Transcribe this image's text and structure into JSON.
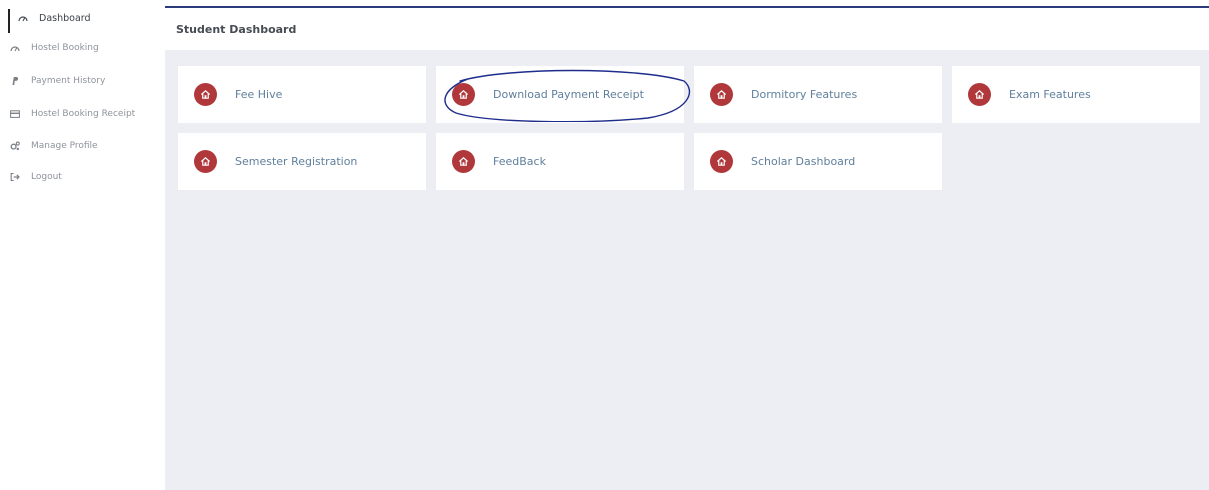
{
  "sidebar": {
    "items": [
      {
        "label": "Dashboard",
        "icon": "dashboard-icon",
        "active": true
      },
      {
        "label": "Hostel Booking",
        "icon": "dashboard-icon",
        "active": false
      },
      {
        "label": "Payment History",
        "icon": "paypal-icon",
        "active": false
      },
      {
        "label": "Hostel Booking Receipt",
        "icon": "card-icon",
        "active": false
      },
      {
        "label": "Manage Profile",
        "icon": "gears-icon",
        "active": false
      },
      {
        "label": "Logout",
        "icon": "logout-icon",
        "active": false
      }
    ]
  },
  "header": {
    "title": "Student Dashboard"
  },
  "cards": [
    {
      "label": "Fee Hive",
      "icon": "home-icon"
    },
    {
      "label": "Download Payment Receipt",
      "icon": "home-icon",
      "annotated": true
    },
    {
      "label": "Dormitory Features",
      "icon": "home-icon"
    },
    {
      "label": "Exam Features",
      "icon": "home-icon"
    },
    {
      "label": "Semester Registration",
      "icon": "home-icon"
    },
    {
      "label": "FeedBack",
      "icon": "home-icon"
    },
    {
      "label": "Scholar Dashboard",
      "icon": "home-icon"
    }
  ],
  "colors": {
    "accent_red": "#b0383b",
    "card_text": "#5f7f9c",
    "main_bg": "#eceef3",
    "annotation_ink": "#1e2d8c"
  }
}
